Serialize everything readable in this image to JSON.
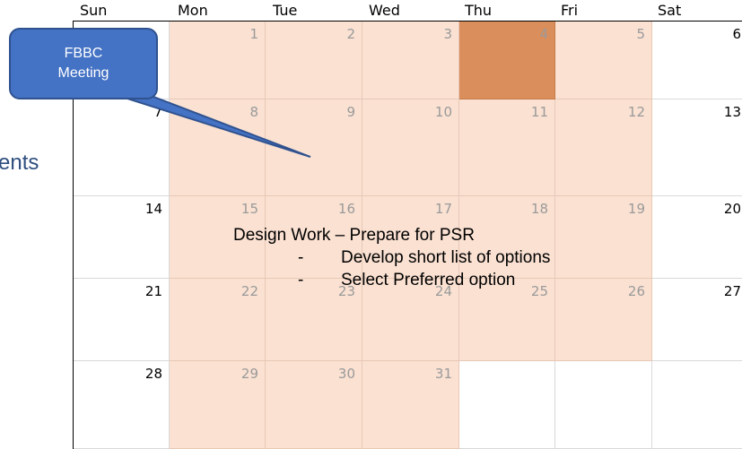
{
  "side_text": "ents",
  "day_names": [
    "Sun",
    "Mon",
    "Tue",
    "Wed",
    "Thu",
    "Fri",
    "Sat"
  ],
  "weeks": [
    [
      "",
      "1",
      "2",
      "3",
      "4",
      "5",
      "6"
    ],
    [
      "7",
      "8",
      "9",
      "10",
      "11",
      "12",
      "13"
    ],
    [
      "14",
      "15",
      "16",
      "17",
      "18",
      "19",
      "20"
    ],
    [
      "21",
      "22",
      "23",
      "24",
      "25",
      "26",
      "27"
    ],
    [
      "28",
      "29",
      "30",
      "31",
      "",
      "",
      ""
    ]
  ],
  "callout": {
    "line1": "FBBC",
    "line2": "Meeting"
  },
  "design": {
    "title": "Design Work – Prepare for PSR",
    "bullets": [
      "Develop short list of options",
      "Select Preferred option"
    ]
  },
  "colors": {
    "highlight": "#fae1d2",
    "today": "#d98e5c",
    "callout": "#4472c4"
  }
}
